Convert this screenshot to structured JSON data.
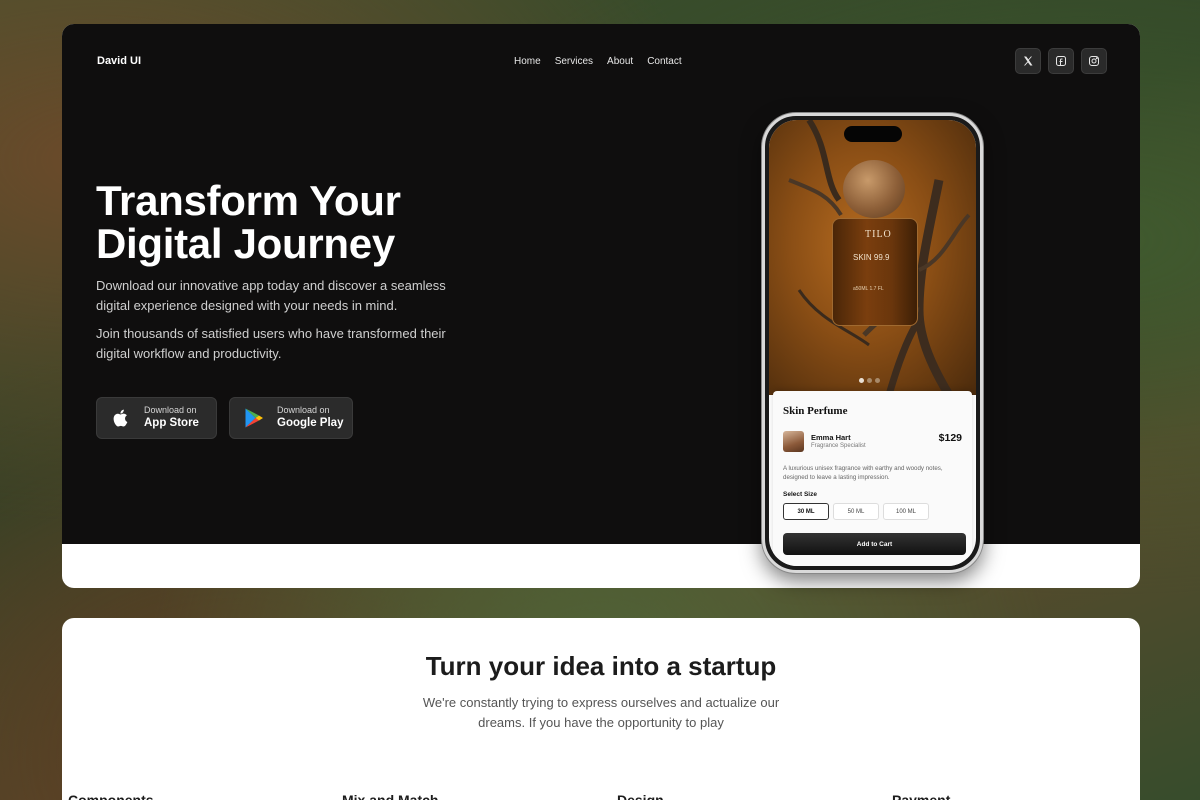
{
  "header": {
    "brand": "David UI",
    "nav": [
      "Home",
      "Services",
      "About",
      "Contact"
    ],
    "socials": [
      "x-icon",
      "facebook-icon",
      "instagram-icon"
    ]
  },
  "hero": {
    "headline_line1": "Transform Your",
    "headline_line2": "Digital Journey",
    "paragraph1": "Download our innovative app today and discover a seamless digital experience designed with your needs in mind.",
    "paragraph2": "Join thousands of satisfied users who have transformed their digital workflow and productivity.",
    "app_store": {
      "small": "Download on",
      "big": "App Store"
    },
    "google_play": {
      "small": "Download on",
      "big": "Google Play"
    }
  },
  "phone": {
    "bottle_brand": "TILO",
    "bottle_label": "SKIN 99.9",
    "bottle_volume": "a50ML 1.7 FL",
    "product_title": "Skin Perfume",
    "seller_name": "Emma Hart",
    "seller_role": "Fragrance Specialist",
    "price": "$129",
    "description": "A luxurious unisex fragrance with earthy and woody notes, designed to leave a lasting impression.",
    "size_label": "Select Size",
    "sizes": [
      "30 ML",
      "50 ML",
      "100 ML"
    ],
    "selected_size": "30 ML",
    "cart_button": "Add to Cart"
  },
  "section2": {
    "title": "Turn your idea into a startup",
    "subtitle": "We're constantly trying to express ourselves and actualize our dreams. If you have the opportunity to play",
    "features": [
      "Components",
      "Mix and Match",
      "Design",
      "Payment"
    ]
  },
  "colors": {
    "hero_bg": "#0f0e0e",
    "card_bg": "#ffffff",
    "button_bg": "#2b2b2b"
  }
}
